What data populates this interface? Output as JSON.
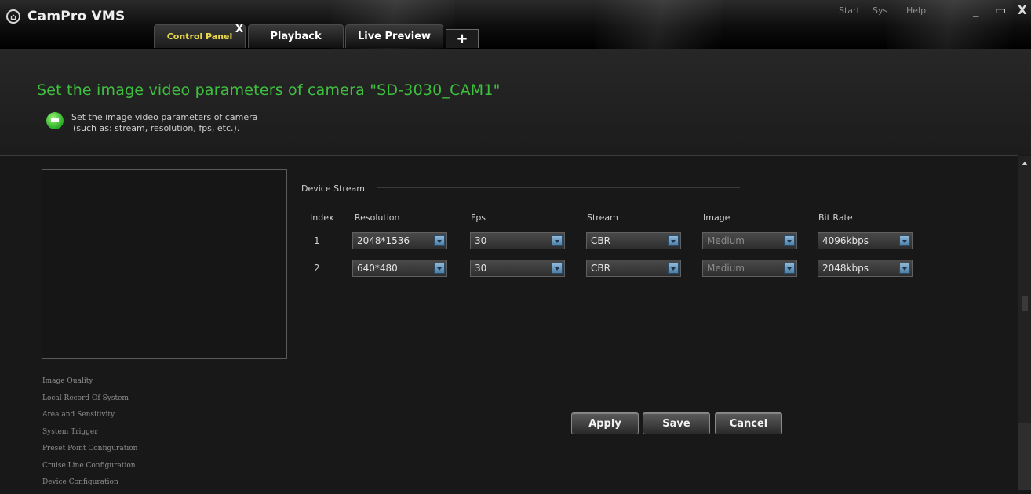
{
  "app": {
    "title": "CamPro VMS"
  },
  "tabs": [
    {
      "label": "Control Panel",
      "active": true
    },
    {
      "label": "Playback",
      "active": false
    },
    {
      "label": "Live Preview",
      "active": false
    }
  ],
  "tab_add_label": "+",
  "tab_close_label": "X",
  "top_menu": {
    "start": "Start",
    "sys": "Sys",
    "help": "Help"
  },
  "window_controls": {
    "minimize": "_",
    "restore": "▭",
    "close": "X"
  },
  "page": {
    "heading": "Set the image video parameters of camera \"SD-3030_CAM1\"",
    "hint_line1": "Set the image video parameters of camera",
    "hint_line2": "(such as: stream, resolution, fps, etc.)."
  },
  "device_stream": {
    "label": "Device Stream",
    "columns": [
      "Index",
      "Resolution",
      "Fps",
      "Stream",
      "Image",
      "Bit Rate"
    ],
    "rows": [
      {
        "index": "1",
        "resolution": "2048*1536",
        "fps": "30",
        "stream": "CBR",
        "image": "Medium",
        "bitrate": "4096kbps"
      },
      {
        "index": "2",
        "resolution": "640*480",
        "fps": "30",
        "stream": "CBR",
        "image": "Medium",
        "bitrate": "2048kbps"
      }
    ]
  },
  "side_menu": [
    "Image Quality",
    "Local Record Of System",
    "Area and Sensitivity",
    "System Trigger",
    "Preset Point Configuration",
    "Cruise Line Configuration",
    "Device Configuration"
  ],
  "buttons": {
    "apply": "Apply",
    "save": "Save",
    "cancel": "Cancel"
  },
  "colors": {
    "heading_green": "#3fbf3f",
    "active_tab_yellow": "#e9d94a",
    "background": "#181818"
  }
}
